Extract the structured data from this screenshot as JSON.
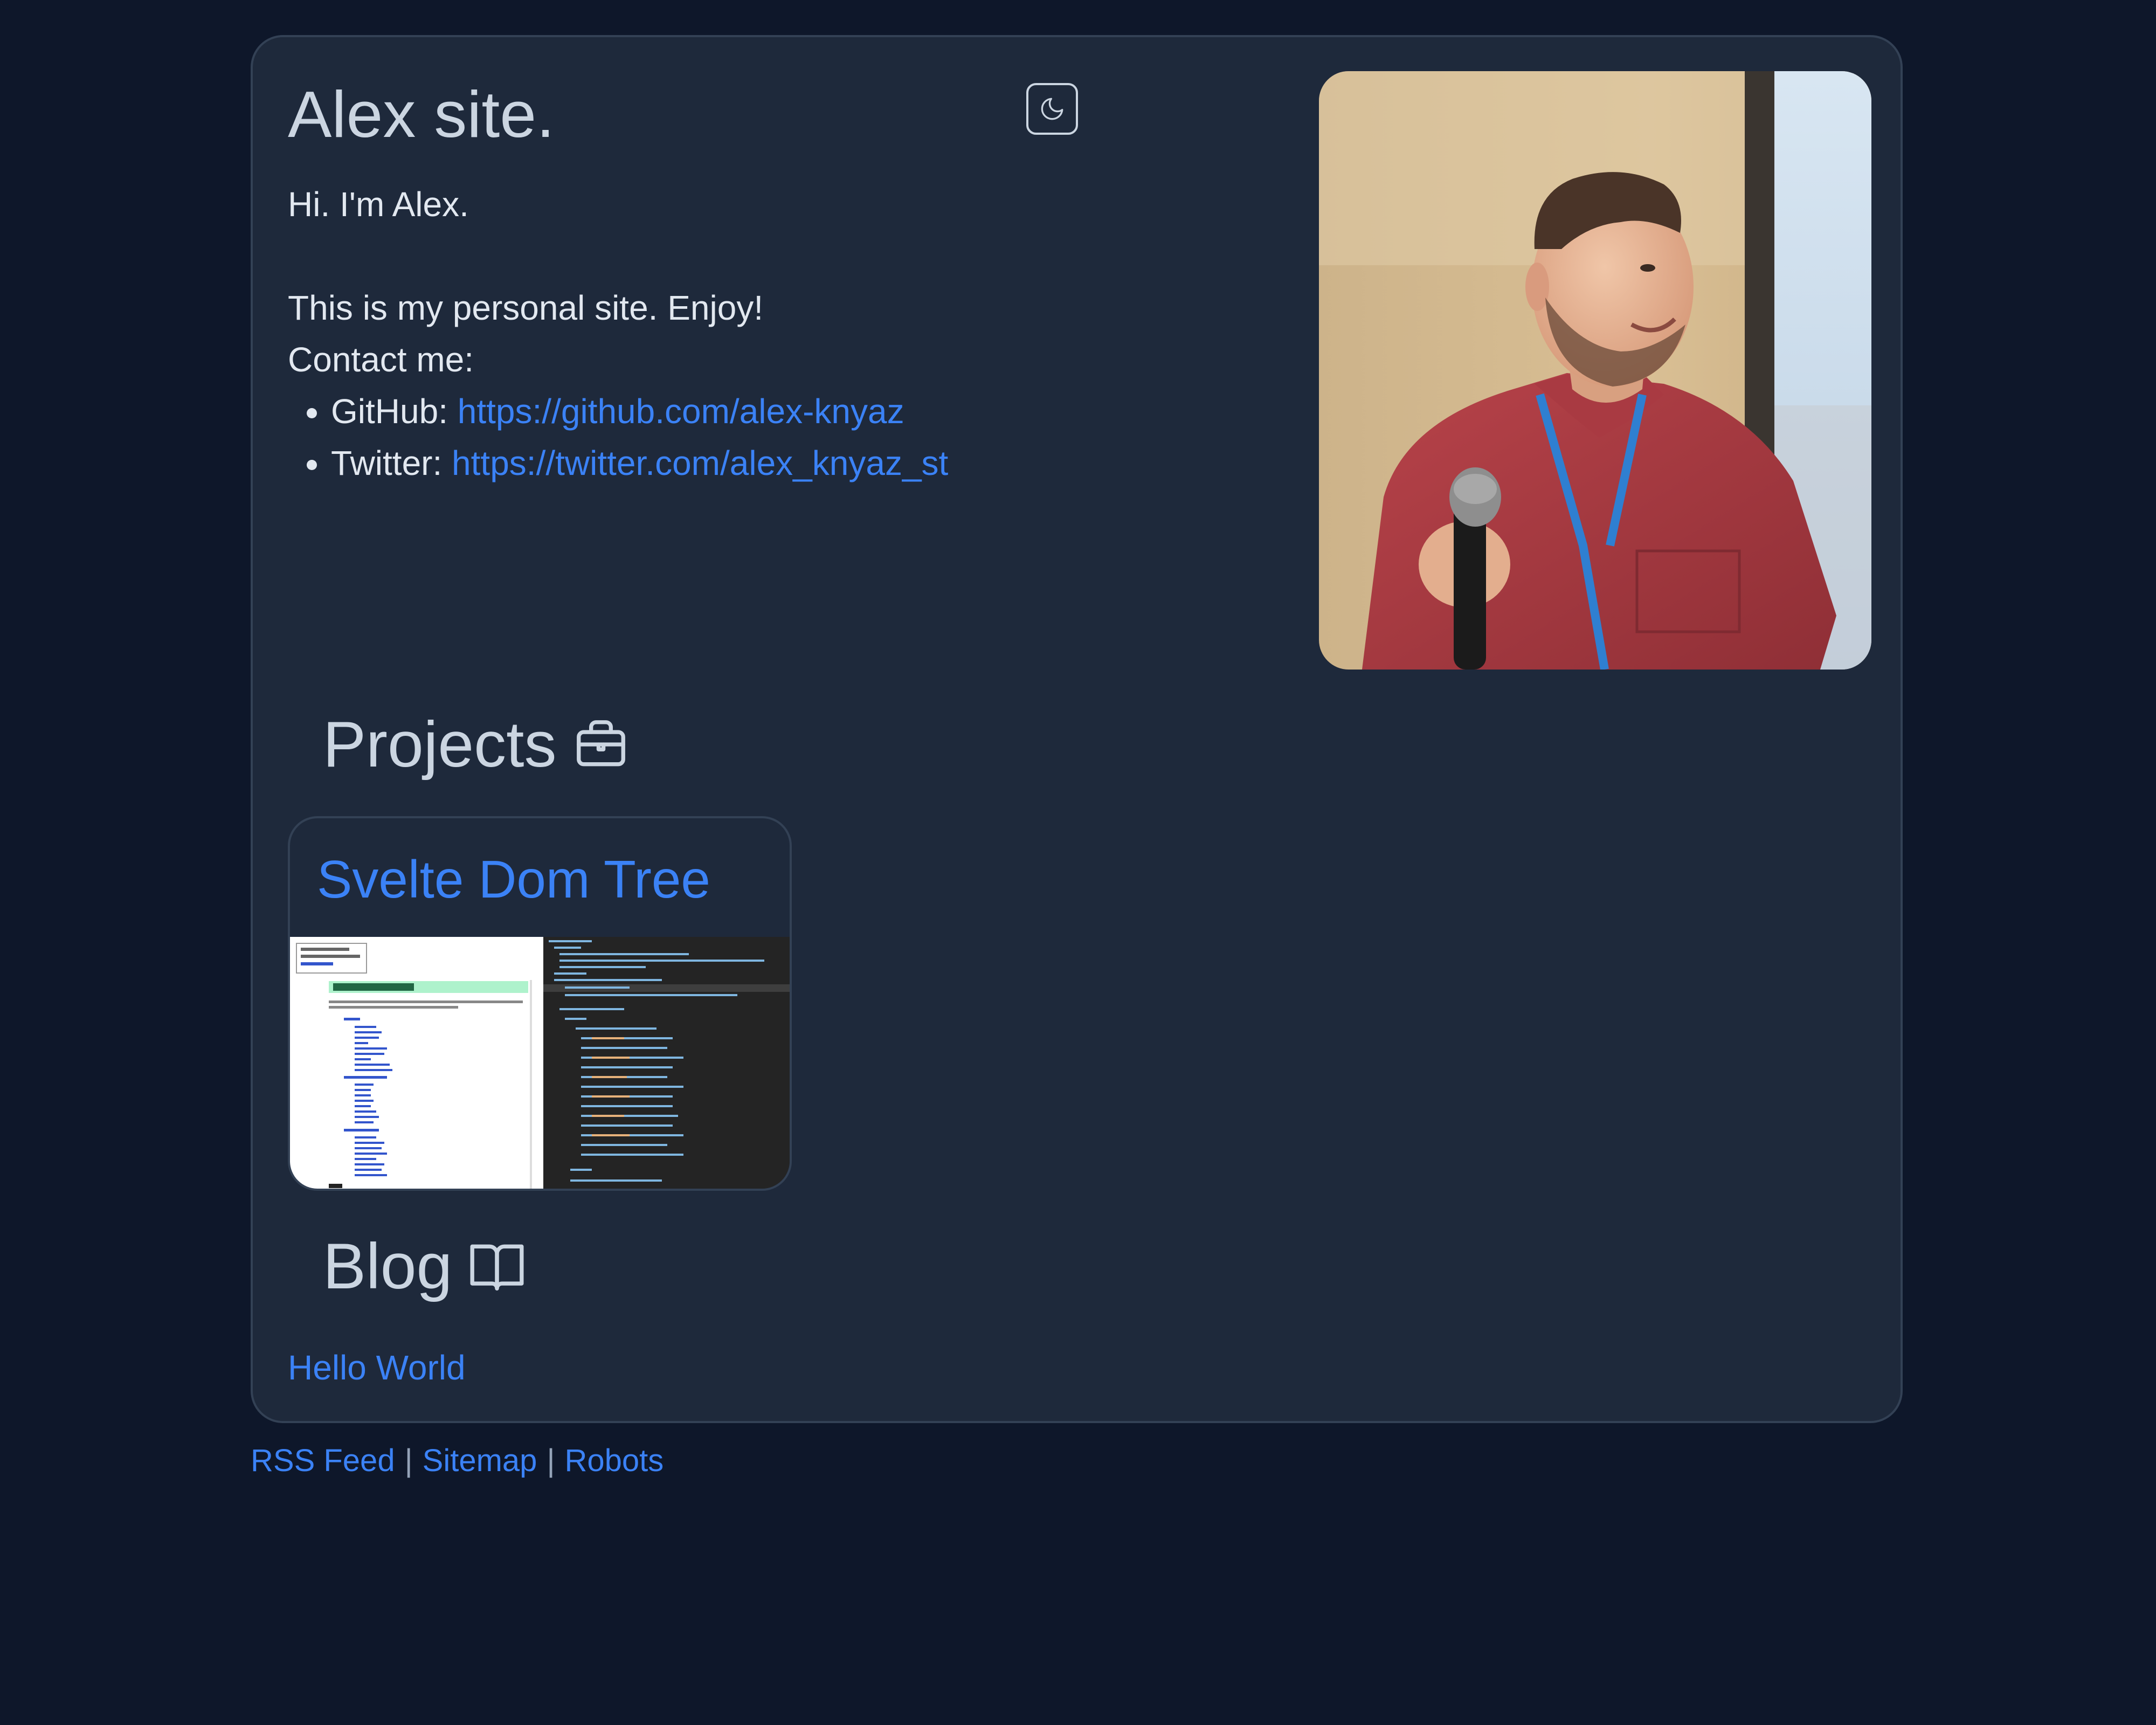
{
  "header": {
    "title": "Alex site.",
    "greeting": "Hi. I'm Alex.",
    "tagline": "This is my personal site. Enjoy!",
    "contact_label": "Contact me:",
    "contacts": [
      {
        "label": "GitHub:",
        "url": "https://github.com/alex-knyaz"
      },
      {
        "label": "Twitter:",
        "url": "https://twitter.com/alex_knyaz_st"
      }
    ],
    "theme_toggle_icon": "moon-icon"
  },
  "projects": {
    "heading": "Projects",
    "icon": "briefcase-icon",
    "items": [
      {
        "title": "Svelte Dom Tree"
      }
    ]
  },
  "blog": {
    "heading": "Blog",
    "icon": "book-open-icon",
    "posts": [
      {
        "title": "Hello World"
      }
    ]
  },
  "footer": {
    "links": [
      "RSS Feed",
      "Sitemap",
      "Robots"
    ],
    "separator": "|"
  },
  "colors": {
    "page_bg": "#0e172a",
    "card_bg": "#1e293b",
    "link": "#3b82f6",
    "text": "#cbd5e1"
  }
}
